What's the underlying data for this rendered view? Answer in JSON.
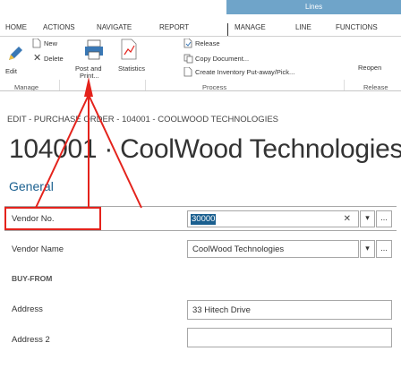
{
  "ribbon": {
    "context_tab": "Lines",
    "tabs": [
      "HOME",
      "ACTIONS",
      "NAVIGATE",
      "REPORT",
      "MANAGE",
      "LINE",
      "FUNCTIONS"
    ],
    "edit_label": "Edit",
    "new_label": "New",
    "delete_label": "Delete",
    "post_and_print_label_1": "Post and",
    "post_and_print_label_2": "Print...",
    "statistics_label": "Statistics",
    "release_label": "Release",
    "copy_document_label": "Copy Document...",
    "create_inventory_label": "Create Inventory Put-away/Pick...",
    "reopen_label": "Reopen",
    "group_manage": "Manage",
    "group_process": "Process",
    "group_release": "Release"
  },
  "page": {
    "breadcrumb": "EDIT - PURCHASE ORDER - 104001 - COOLWOOD TECHNOLOGIES",
    "title": "104001 · CoolWood Technologies",
    "section": "General"
  },
  "form": {
    "vendor_no_label": "Vendor No.",
    "vendor_no_value": "30000",
    "vendor_name_label": "Vendor Name",
    "vendor_name_value": "CoolWood Technologies",
    "buy_from_label": "BUY-FROM",
    "address_label": "Address",
    "address_value": "33 Hitech Drive",
    "address2_label": "Address 2",
    "address2_value": "",
    "clear_glyph": "✕",
    "more_glyph": "..."
  },
  "colors": {
    "accent": "#1a5f8f",
    "context_tab": "#6fa4c9",
    "annotation": "#e4231c"
  }
}
